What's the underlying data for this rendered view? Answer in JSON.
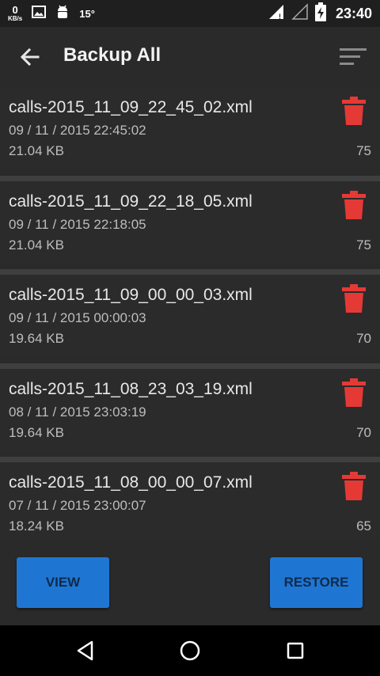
{
  "status_bar": {
    "speed_value": "0",
    "speed_unit": "KB/s",
    "temperature": "15°",
    "time": "23:40"
  },
  "app_bar": {
    "title": "Backup All"
  },
  "backups": [
    {
      "filename": "calls-2015_11_09_22_45_02.xml",
      "date": "09 / 11 / 2015 22:45:02",
      "size": "21.04 KB",
      "count": "75"
    },
    {
      "filename": "calls-2015_11_09_22_18_05.xml",
      "date": "09 / 11 / 2015 22:18:05",
      "size": "21.04 KB",
      "count": "75"
    },
    {
      "filename": "calls-2015_11_09_00_00_03.xml",
      "date": "09 / 11 / 2015 00:00:03",
      "size": "19.64 KB",
      "count": "70"
    },
    {
      "filename": "calls-2015_11_08_23_03_19.xml",
      "date": "08 / 11 / 2015 23:03:19",
      "size": "19.64 KB",
      "count": "70"
    },
    {
      "filename": "calls-2015_11_08_00_00_07.xml",
      "date": "07 / 11 / 2015 23:00:07",
      "size": "18.24 KB",
      "count": "65"
    }
  ],
  "buttons": {
    "view": "VIEW",
    "restore": "RESTORE"
  },
  "colors": {
    "delete_icon": "#e53935",
    "button_bg": "#1f76d2",
    "background": "#2a2a2a"
  }
}
